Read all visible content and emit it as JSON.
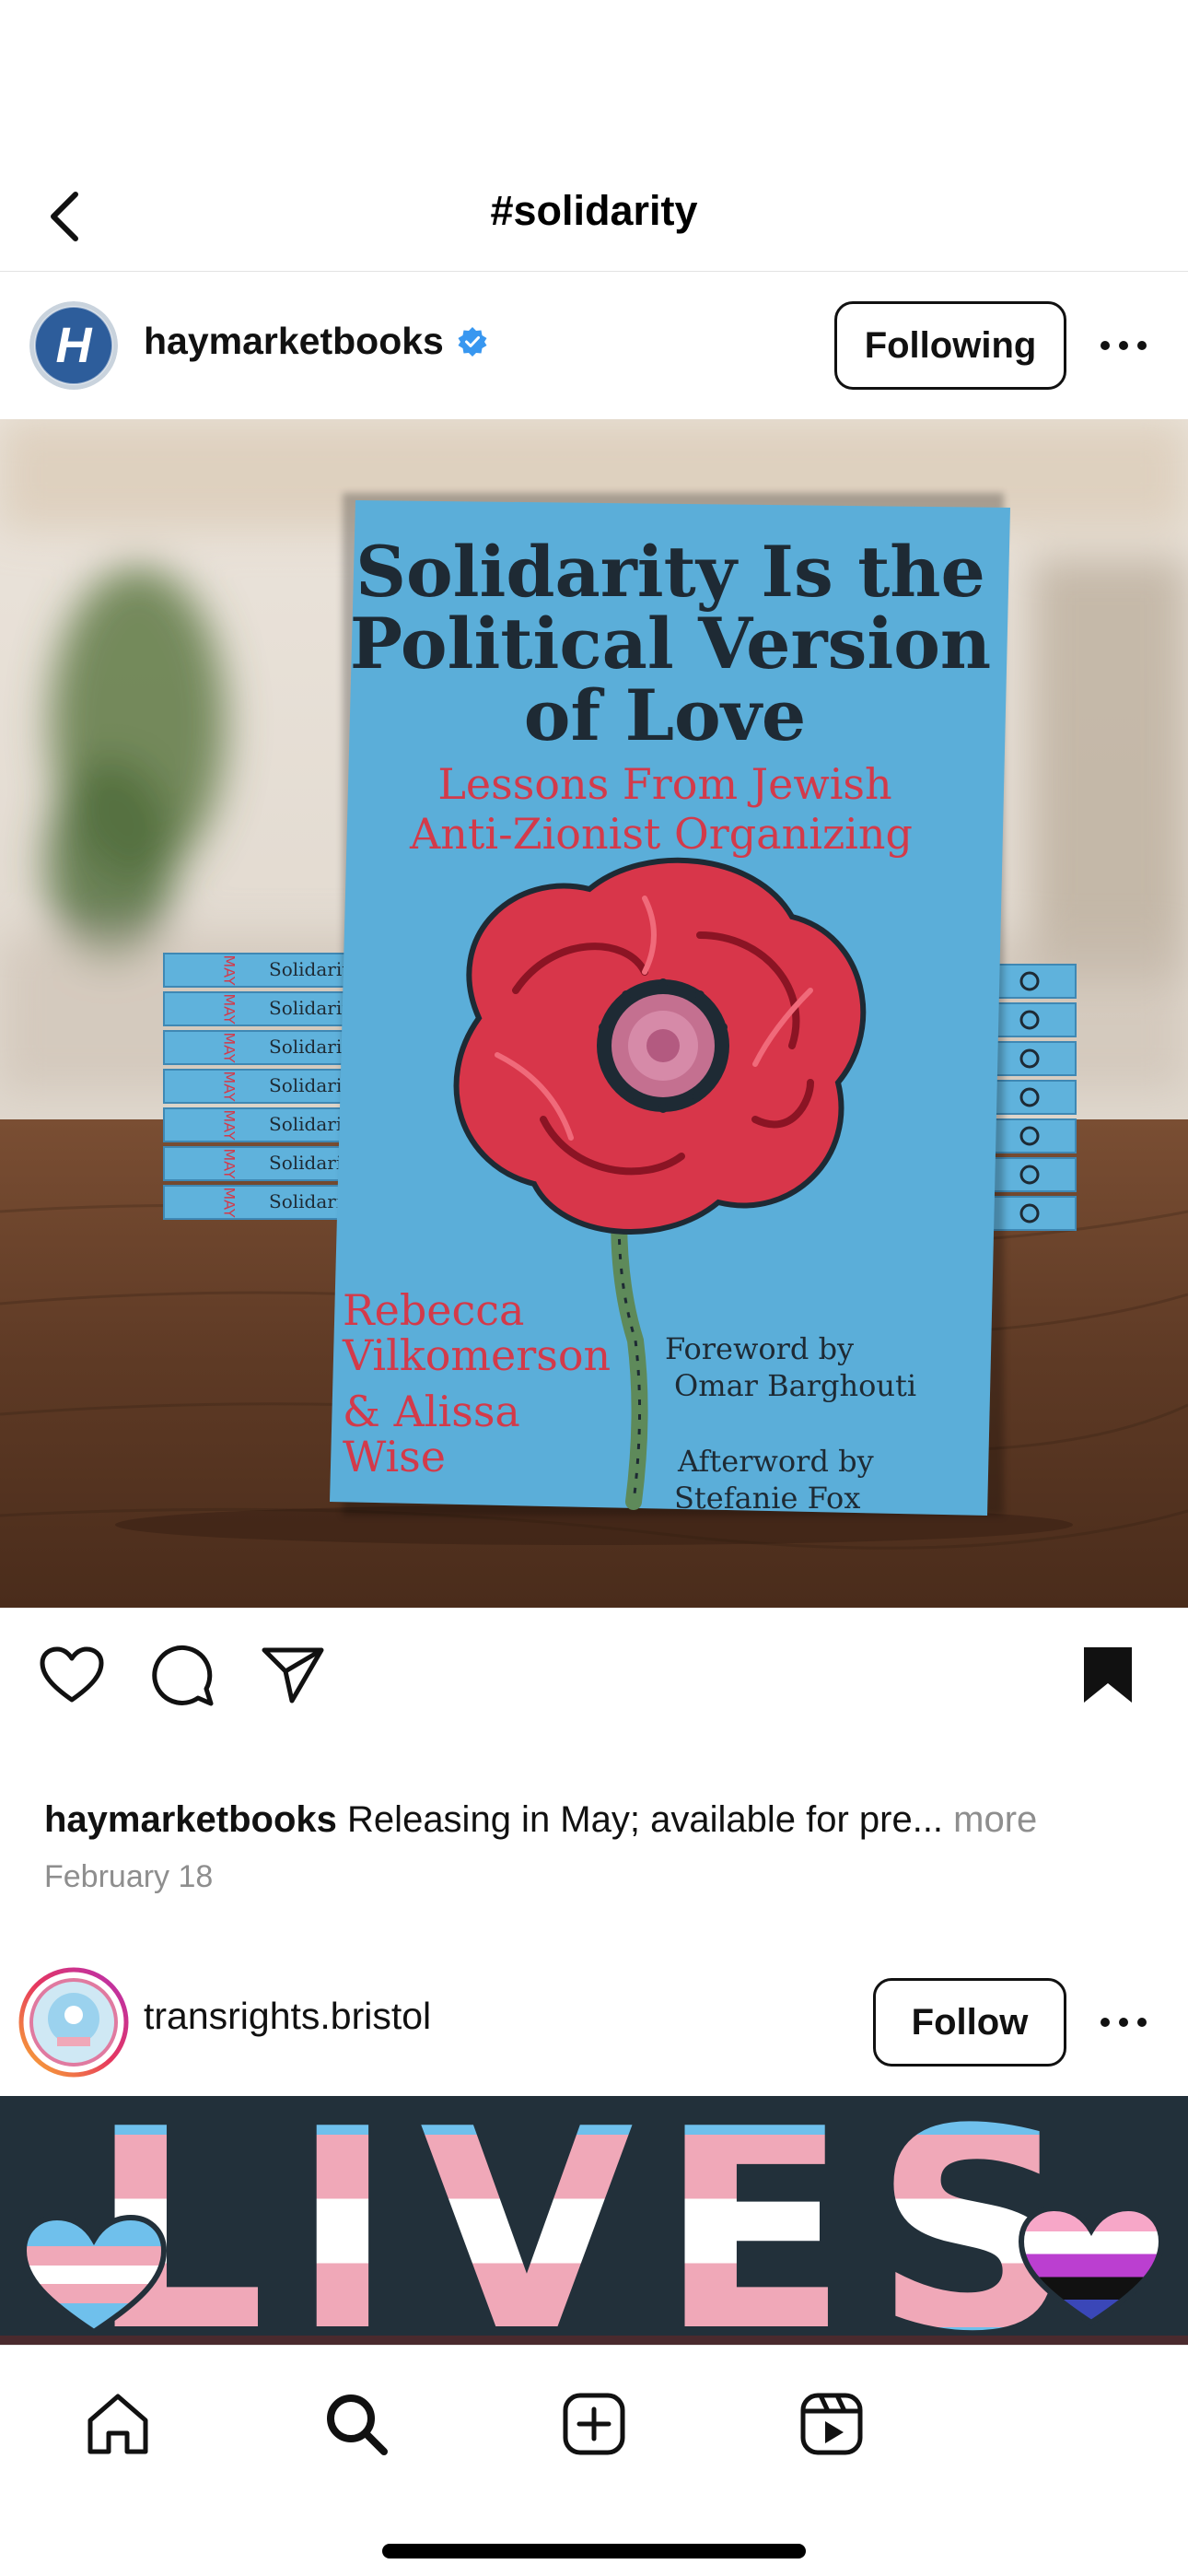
{
  "header": {
    "title": "#solidarity",
    "back_icon": "chevron-left-icon"
  },
  "post1": {
    "username": "haymarketbooks",
    "avatar_letter": "H",
    "verified": true,
    "verified_color": "#3897f0",
    "follow_label": "Following",
    "more_icon": "ellipsis-icon",
    "book": {
      "title_lines": [
        "Solidarity Is the",
        "Political Version",
        "of Love"
      ],
      "subtitle_lines": [
        "Lessons From Jewish",
        "Anti-Zionist Organizing"
      ],
      "authors_lines": [
        "Rebecca",
        "Vilkomerson",
        "& Alissa",
        "Wise"
      ],
      "foreword_lines": [
        "Foreword by",
        "Omar Barghouti"
      ],
      "afterword_lines": [
        "Afterword by",
        "Stefanie Fox"
      ],
      "spine_text": "Solidarity",
      "spine_month": "MAY",
      "cover_color": "#5fb2dc",
      "title_color": "#1e2a34",
      "accent_color": "#d33a4a"
    },
    "actions": {
      "like_icon": "heart-icon",
      "comment_icon": "comment-icon",
      "share_icon": "paper-plane-icon",
      "save_icon": "bookmark-icon"
    },
    "caption": {
      "username": "haymarketbooks",
      "text": "Releasing in May; available for pre...",
      "more": "more"
    },
    "date": "February 18"
  },
  "post2": {
    "username": "transrights.bristol",
    "follow_label": "Follow",
    "more_icon": "ellipsis-icon",
    "banner_text": "LIVES"
  },
  "tab_bar": {
    "items": [
      "home-icon",
      "search-icon",
      "create-icon",
      "reels-icon"
    ]
  },
  "colors": {
    "trans_blue": "#6fc0ec",
    "trans_pink": "#f0a8b8",
    "trans_white": "#ffffff",
    "banner_bg": "#22303a"
  }
}
